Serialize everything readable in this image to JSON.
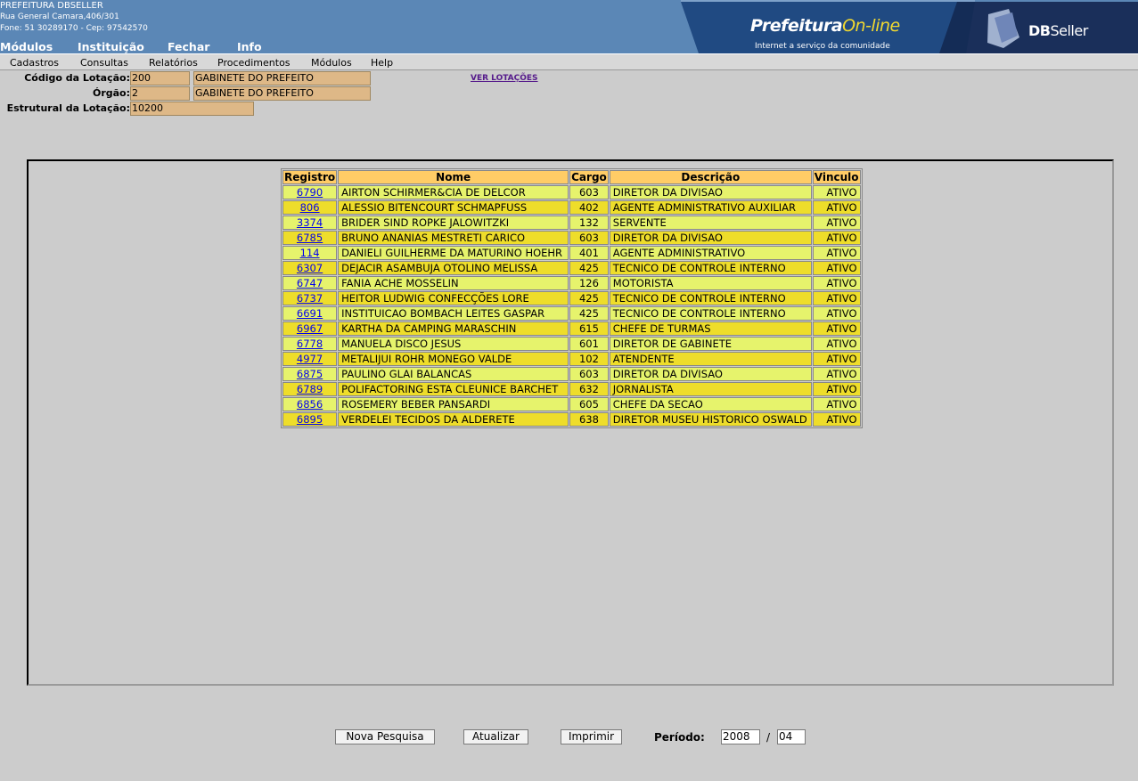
{
  "header": {
    "org_name": "PREFEITURA DBSELLER",
    "address": "Rua General Camara,406/301",
    "phone_line": "Fone: 51 30289170  -  Cep: 97542570",
    "nav": [
      "Módulos",
      "Instituição",
      "Fechar",
      "Info"
    ],
    "banner_title_a": "Prefeitura",
    "banner_title_b": "On-line",
    "banner_subtitle": "Internet a serviço da comunidade",
    "banner_brand_a": "DB",
    "banner_brand_b": "Seller"
  },
  "menu": [
    "Cadastros",
    "Consultas",
    "Relatórios",
    "Procedimentos",
    "Módulos",
    "Help"
  ],
  "form": {
    "codigo_label": "Código da Lotação:",
    "codigo_value": "200",
    "codigo_desc": "GABINETE DO PREFEITO",
    "orgao_label": "Órgão:",
    "orgao_value": "2",
    "orgao_desc": "GABINETE DO PREFEITO",
    "estrutural_label": "Estrutural da Lotação:",
    "estrutural_value": "10200",
    "ver_lotacoes": "VER LOTAÇÕES"
  },
  "table": {
    "headers": [
      "Registro",
      "Nome",
      "Cargo",
      "Descrição",
      "Vinculo"
    ],
    "rows": [
      {
        "registro": "6790",
        "nome": "AIRTON SCHIRMER&CIA DE DELCOR",
        "cargo": "603",
        "descricao": "DIRETOR DA DIVISAO",
        "vinculo": "ATIVO"
      },
      {
        "registro": "806",
        "nome": "ALESSIO BITENCOURT SCHMAPFUSS",
        "cargo": "402",
        "descricao": "AGENTE ADMINISTRATIVO AUXILIAR",
        "vinculo": "ATIVO"
      },
      {
        "registro": "3374",
        "nome": "BRIDER SIND ROPKE JALOWITZKI",
        "cargo": "132",
        "descricao": "SERVENTE",
        "vinculo": "ATIVO"
      },
      {
        "registro": "6785",
        "nome": "BRUNO ANANIAS MESTRETI CARICO",
        "cargo": "603",
        "descricao": "DIRETOR DA DIVISAO",
        "vinculo": "ATIVO"
      },
      {
        "registro": "114",
        "nome": "DANIELI GUILHERME DA MATURINO HOEHR",
        "cargo": "401",
        "descricao": "AGENTE ADMINISTRATIVO",
        "vinculo": "ATIVO"
      },
      {
        "registro": "6307",
        "nome": "DEJACIR ASAMBUJA OTOLINO MELISSA",
        "cargo": "425",
        "descricao": "TECNICO DE CONTROLE INTERNO",
        "vinculo": "ATIVO"
      },
      {
        "registro": "6747",
        "nome": "FANIA ACHE MOSSELIN",
        "cargo": "126",
        "descricao": "MOTORISTA",
        "vinculo": "ATIVO"
      },
      {
        "registro": "6737",
        "nome": "HEITOR LUDWIG CONFECÇÕES LORE",
        "cargo": "425",
        "descricao": "TECNICO DE CONTROLE INTERNO",
        "vinculo": "ATIVO"
      },
      {
        "registro": "6691",
        "nome": "INSTITUICAO BOMBACH LEITES GASPAR",
        "cargo": "425",
        "descricao": "TECNICO DE CONTROLE INTERNO",
        "vinculo": "ATIVO"
      },
      {
        "registro": "6967",
        "nome": "KARTHA DA CAMPING MARASCHIN",
        "cargo": "615",
        "descricao": "CHEFE DE TURMAS",
        "vinculo": "ATIVO"
      },
      {
        "registro": "6778",
        "nome": "MANUELA DISCO JESUS",
        "cargo": "601",
        "descricao": "DIRETOR DE GABINETE",
        "vinculo": "ATIVO"
      },
      {
        "registro": "4977",
        "nome": "METALIJUI ROHR MONEGO VALDE",
        "cargo": "102",
        "descricao": "ATENDENTE",
        "vinculo": "ATIVO"
      },
      {
        "registro": "6875",
        "nome": "PAULINO GLAI BALANCAS",
        "cargo": "603",
        "descricao": "DIRETOR DA DIVISAO",
        "vinculo": "ATIVO"
      },
      {
        "registro": "6789",
        "nome": "POLIFACTORING ESTA CLEUNICE BARCHET",
        "cargo": "632",
        "descricao": "JORNALISTA",
        "vinculo": "ATIVO"
      },
      {
        "registro": "6856",
        "nome": "ROSEMERY BEBER PANSARDI",
        "cargo": "605",
        "descricao": "CHEFE DA SECAO",
        "vinculo": "ATIVO"
      },
      {
        "registro": "6895",
        "nome": "VERDELEI TECIDOS DA ALDERETE",
        "cargo": "638",
        "descricao": "DIRETOR MUSEU HISTORICO OSWALD",
        "vinculo": "ATIVO"
      }
    ]
  },
  "footer": {
    "nova_pesquisa": "Nova Pesquisa",
    "atualizar": "Atualizar",
    "imprimir": "Imprimir",
    "periodo_label": "Período:",
    "ano": "2008",
    "mes": "04",
    "separator": "/"
  }
}
